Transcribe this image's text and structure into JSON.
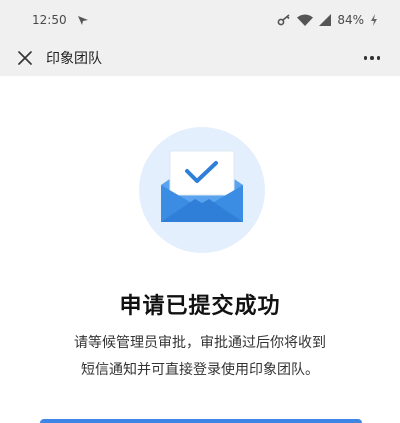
{
  "status_bar": {
    "time": "12:50",
    "battery": "84%"
  },
  "nav": {
    "title": "印象团队",
    "close_icon": "close-icon",
    "more_icon": "more-horizontal-icon"
  },
  "main": {
    "illustration_icon": "envelope-check-icon",
    "title": "申请已提交成功",
    "description_lines": [
      "请等候管理员审批，审批通过后你将收到",
      "短信通知并可直接登录使用印象团队。"
    ]
  },
  "colors": {
    "accent": "#3d86e6",
    "circle": "#e3effc",
    "envelope": "#3b8ce3"
  }
}
